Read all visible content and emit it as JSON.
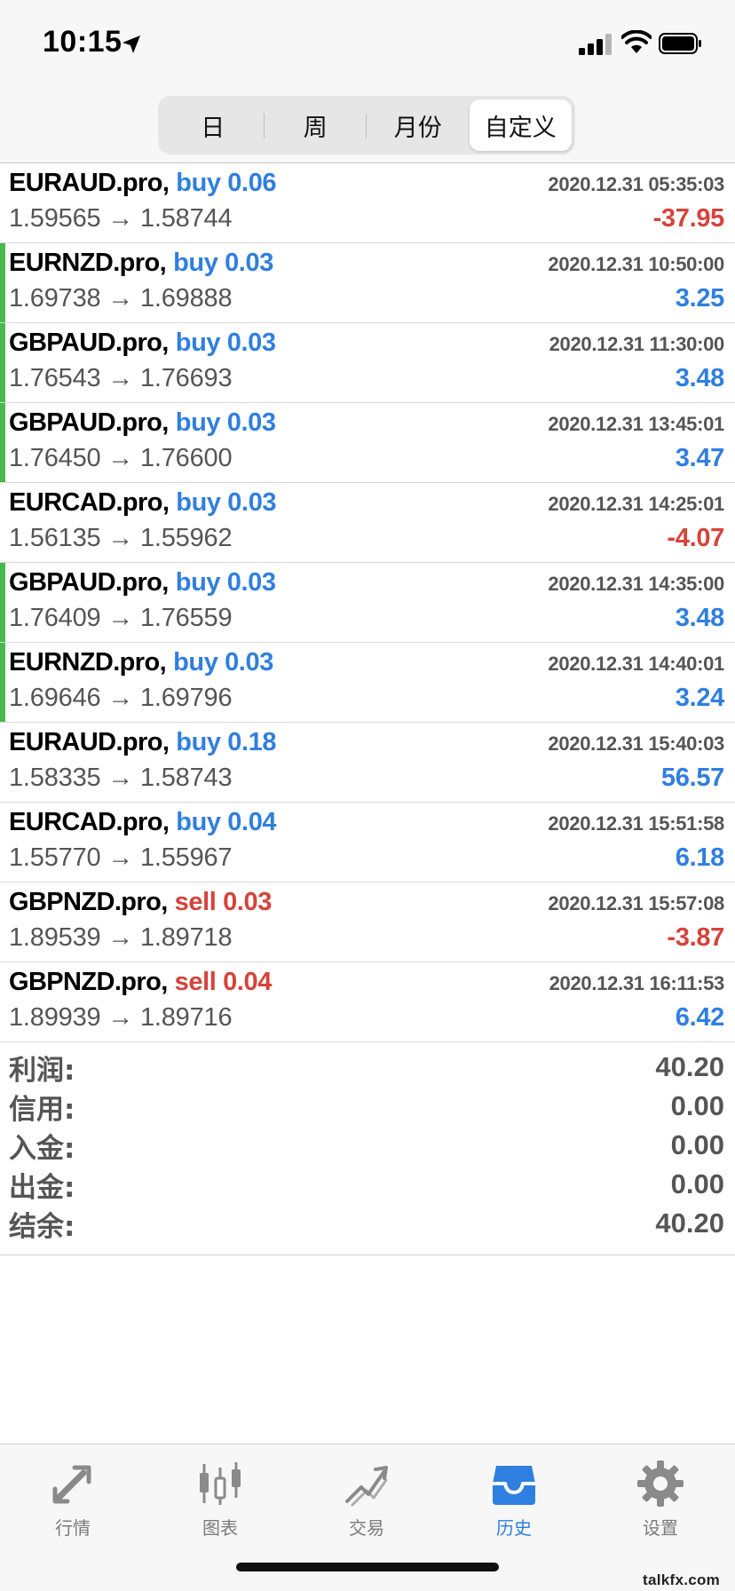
{
  "status_bar": {
    "time": "10:15"
  },
  "segments": [
    {
      "label": "日",
      "active": false
    },
    {
      "label": "周",
      "active": false
    },
    {
      "label": "月份",
      "active": false
    },
    {
      "label": "自定义",
      "active": true
    }
  ],
  "trades": [
    {
      "symbol": "EURAUD.pro,",
      "direction": "buy",
      "volume": "buy 0.06",
      "datetime": "2020.12.31 05:35:03",
      "prices": "1.59565 → 1.58744",
      "profit": "-37.95",
      "profit_sign": "neg",
      "marker": false
    },
    {
      "symbol": "EURNZD.pro,",
      "direction": "buy",
      "volume": "buy 0.03",
      "datetime": "2020.12.31 10:50:00",
      "prices": "1.69738 → 1.69888",
      "profit": "3.25",
      "profit_sign": "pos",
      "marker": true
    },
    {
      "symbol": "GBPAUD.pro,",
      "direction": "buy",
      "volume": "buy 0.03",
      "datetime": "2020.12.31 11:30:00",
      "prices": "1.76543 → 1.76693",
      "profit": "3.48",
      "profit_sign": "pos",
      "marker": true
    },
    {
      "symbol": "GBPAUD.pro,",
      "direction": "buy",
      "volume": "buy 0.03",
      "datetime": "2020.12.31 13:45:01",
      "prices": "1.76450 → 1.76600",
      "profit": "3.47",
      "profit_sign": "pos",
      "marker": true
    },
    {
      "symbol": "EURCAD.pro,",
      "direction": "buy",
      "volume": "buy 0.03",
      "datetime": "2020.12.31 14:25:01",
      "prices": "1.56135 → 1.55962",
      "profit": "-4.07",
      "profit_sign": "neg",
      "marker": false
    },
    {
      "symbol": "GBPAUD.pro,",
      "direction": "buy",
      "volume": "buy 0.03",
      "datetime": "2020.12.31 14:35:00",
      "prices": "1.76409 → 1.76559",
      "profit": "3.48",
      "profit_sign": "pos",
      "marker": true
    },
    {
      "symbol": "EURNZD.pro,",
      "direction": "buy",
      "volume": "buy 0.03",
      "datetime": "2020.12.31 14:40:01",
      "prices": "1.69646 → 1.69796",
      "profit": "3.24",
      "profit_sign": "pos",
      "marker": true
    },
    {
      "symbol": "EURAUD.pro,",
      "direction": "buy",
      "volume": "buy 0.18",
      "datetime": "2020.12.31 15:40:03",
      "prices": "1.58335 → 1.58743",
      "profit": "56.57",
      "profit_sign": "pos",
      "marker": false
    },
    {
      "symbol": "EURCAD.pro,",
      "direction": "buy",
      "volume": "buy 0.04",
      "datetime": "2020.12.31 15:51:58",
      "prices": "1.55770 → 1.55967",
      "profit": "6.18",
      "profit_sign": "pos",
      "marker": false
    },
    {
      "symbol": "GBPNZD.pro,",
      "direction": "sell",
      "volume": "sell 0.03",
      "datetime": "2020.12.31 15:57:08",
      "prices": "1.89539 → 1.89718",
      "profit": "-3.87",
      "profit_sign": "neg",
      "marker": false
    },
    {
      "symbol": "GBPNZD.pro,",
      "direction": "sell",
      "volume": "sell 0.04",
      "datetime": "2020.12.31 16:11:53",
      "prices": "1.89939 → 1.89716",
      "profit": "6.42",
      "profit_sign": "pos",
      "marker": false
    }
  ],
  "summary": {
    "profit_label": "利润:",
    "profit_value": "40.20",
    "credit_label": "信用:",
    "credit_value": "0.00",
    "deposit_label": "入金:",
    "deposit_value": "0.00",
    "withdrawal_label": "出金:",
    "withdrawal_value": "0.00",
    "balance_label": "结余:",
    "balance_value": "40.20"
  },
  "tabs": [
    {
      "label": "行情",
      "icon": "quotes-icon",
      "active": false
    },
    {
      "label": "图表",
      "icon": "chart-icon",
      "active": false
    },
    {
      "label": "交易",
      "icon": "trade-icon",
      "active": false
    },
    {
      "label": "历史",
      "icon": "history-icon",
      "active": true
    },
    {
      "label": "设置",
      "icon": "settings-icon",
      "active": false
    }
  ],
  "watermark": "talkfx.com",
  "colors": {
    "buy": "#2f7fe0",
    "sell": "#d6433a",
    "profit_positive": "#2f7fe0",
    "profit_negative": "#d6433a",
    "marker": "#46b94a",
    "tab_active": "#2f7fe0",
    "tab_inactive": "#7b7b7b"
  }
}
